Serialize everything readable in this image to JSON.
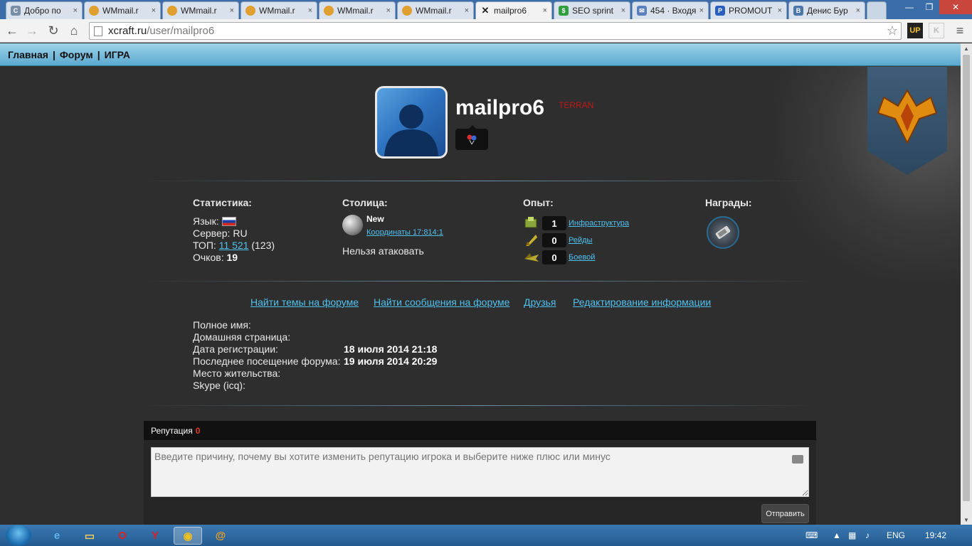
{
  "browser": {
    "tabs": [
      {
        "title": "Добро по",
        "icon": "generic-page-icon",
        "color": "#7a8ea8"
      },
      {
        "title": "WMmail.r",
        "icon": "wmmail-icon",
        "color": "#e0a030"
      },
      {
        "title": "WMmail.r",
        "icon": "wmmail-icon",
        "color": "#e0a030"
      },
      {
        "title": "WMmail.r",
        "icon": "wmmail-icon",
        "color": "#e0a030"
      },
      {
        "title": "WMmail.r",
        "icon": "wmmail-icon",
        "color": "#e0a030"
      },
      {
        "title": "WMmail.r",
        "icon": "wmmail-icon",
        "color": "#e0a030"
      },
      {
        "title": "mailpro6",
        "icon": "xcraft-icon",
        "color": "#222222",
        "active": true
      },
      {
        "title": "SEO sprint",
        "icon": "seosprint-icon",
        "color": "#2e9e3e"
      },
      {
        "title": "454 · Входя",
        "icon": "mail-icon",
        "color": "#5a7fbf"
      },
      {
        "title": "PROMOUT",
        "icon": "promout-icon",
        "color": "#2a5fc0"
      },
      {
        "title": "Денис Бур",
        "icon": "vk-icon",
        "color": "#4a76a8"
      }
    ],
    "url_host": "xcraft.ru",
    "url_path": "/user/mailpro6",
    "extensions": [
      "UP",
      "K"
    ]
  },
  "site": {
    "nav": [
      "Главная",
      "Форум",
      "ИГРА"
    ],
    "nav_separator": "|"
  },
  "profile": {
    "username": "mailpro6",
    "race": "TERRAN"
  },
  "stats": {
    "heading": "Статистика:",
    "language_label": "Язык:",
    "server_label": "Сервер:",
    "server_value": "RU",
    "top_label": "ТОП:",
    "top_value": "11 521",
    "top_extra": "(123)",
    "points_label": "Очков:",
    "points_value": "19"
  },
  "capital": {
    "heading": "Столица:",
    "name": "New",
    "coords": "Координаты 17:814:1",
    "status": "Нельзя атаковать"
  },
  "experience": {
    "heading": "Опыт:",
    "items": [
      {
        "value": "1",
        "label": "Инфраструктура",
        "icon": "infrastructure-icon"
      },
      {
        "value": "0",
        "label": "Рейды",
        "icon": "raid-icon"
      },
      {
        "value": "0",
        "label": "Боевой",
        "icon": "combat-icon"
      }
    ]
  },
  "awards": {
    "heading": "Награды:"
  },
  "actions": [
    "Найти темы на форуме",
    "Найти сообщения на форуме",
    "Друзья",
    "Редактирование информации"
  ],
  "info": [
    {
      "label": "Полное имя:",
      "value": ""
    },
    {
      "label": "Домашняя страница:",
      "value": ""
    },
    {
      "label": "Дата регистрации:",
      "value": "18 июля 2014 21:18"
    },
    {
      "label": "Последнее посещение форума:",
      "value": "19 июля 2014 20:29"
    },
    {
      "label": "Место жительства:",
      "value": ""
    },
    {
      "label": "Skype (icq):",
      "value": ""
    }
  ],
  "reputation": {
    "label": "Репутация",
    "value": "0",
    "placeholder": "Введите причину, почему вы хотите изменить репутацию игрока и выберите ниже плюс или минус",
    "send_label": "Отправить"
  },
  "taskbar": {
    "language": "ENG",
    "time": "19:42"
  },
  "colors": {
    "link": "#4fc1f0",
    "race": "#c01818",
    "reputation_value": "#e03a2a",
    "page_bg": "#2e2e2e"
  }
}
